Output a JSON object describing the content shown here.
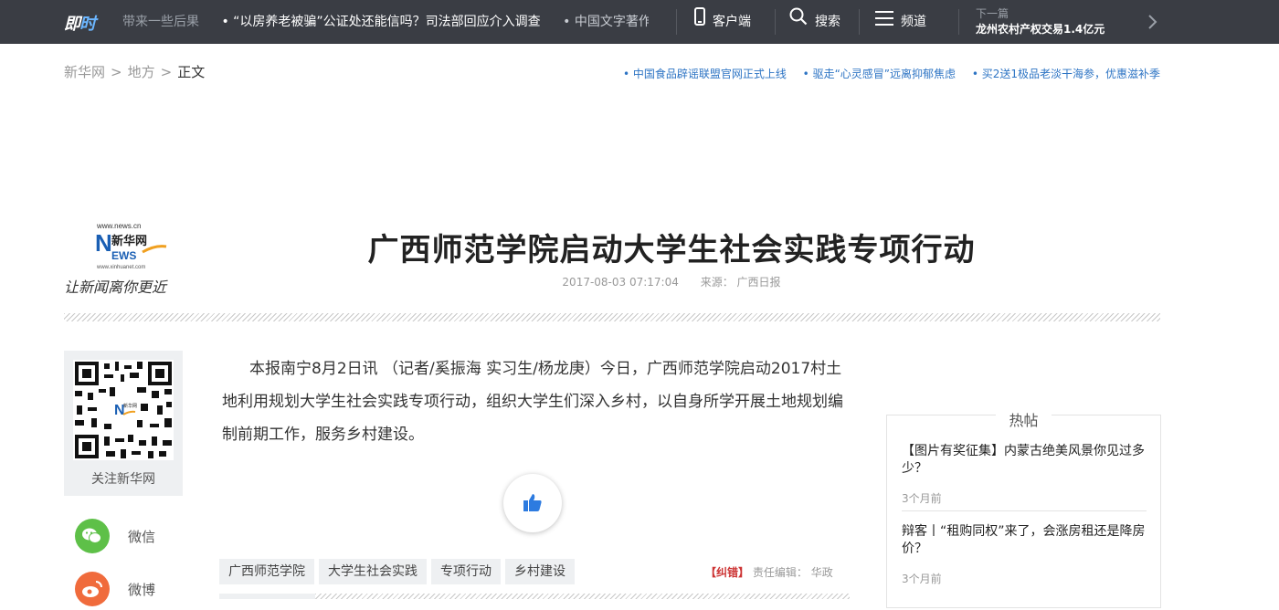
{
  "topbar": {
    "logo": {
      "part1": "即",
      "part2": "时"
    },
    "ticker": [
      "带来一些后果",
      "• “以房养老被骗”公证处还能信吗？司法部回应介入调查",
      "• 中国文字著作权"
    ],
    "client_label": "客户端",
    "search_label": "搜索",
    "channel_label": "频道",
    "next_label": "下一篇",
    "next_title": "龙州农村产权交易1.4亿元"
  },
  "breadcrumb": {
    "home": "新华网",
    "sep": ">",
    "section": "地方",
    "current": "正文"
  },
  "top_links": [
    "• 中国食品辟谣联盟官网正式上线",
    "• 驱走“心灵感冒”远离抑郁焦虑",
    "• 买2送1极品老淡干海参，优惠滋补季"
  ],
  "logo": {
    "url": "www.news.cn",
    "brand": "新华网",
    "news": "NEWS",
    "site": "www.xinhuanet.com",
    "slogan": "让新闻离你更近"
  },
  "article": {
    "title": "广西师范学院启动大学生社会实践专项行动",
    "date": "2017-08-03 07:17:04",
    "source_label": "来源：",
    "source": "广西日报",
    "body": "本报南宁8月2日讯 （记者/奚振海 实习生/杨龙庚）今日，广西师范学院启动2017村土地利用规划大学生社会实践专项行动，组织大学生们深入乡村，以自身所学开展土地规划编制前期工作，服务乡村建设。",
    "tags": [
      "广西师范学院",
      "大学生社会实践",
      "专项行动",
      "乡村建设"
    ],
    "correction": "【纠错】",
    "editor_label": "责任编辑：",
    "editor": "华政"
  },
  "sidebar": {
    "qr_label": "关注新华网",
    "qr_badge": "新华网",
    "wechat_label": "微信",
    "weibo_label": "微博"
  },
  "hot": {
    "title": "热帖",
    "items": [
      {
        "title": "【图片有奖征集】内蒙古绝美风景你见过多少？",
        "date": "3个月前"
      },
      {
        "title": "辩客丨“租购同权”来了，会涨房租还是降房价？",
        "date": "3个月前"
      }
    ]
  },
  "colors": {
    "topbar": "#3a3d44",
    "link": "#2d74c4",
    "wechat": "#5ec048",
    "weibo": "#f06b3c",
    "like": "#2d7be0"
  }
}
